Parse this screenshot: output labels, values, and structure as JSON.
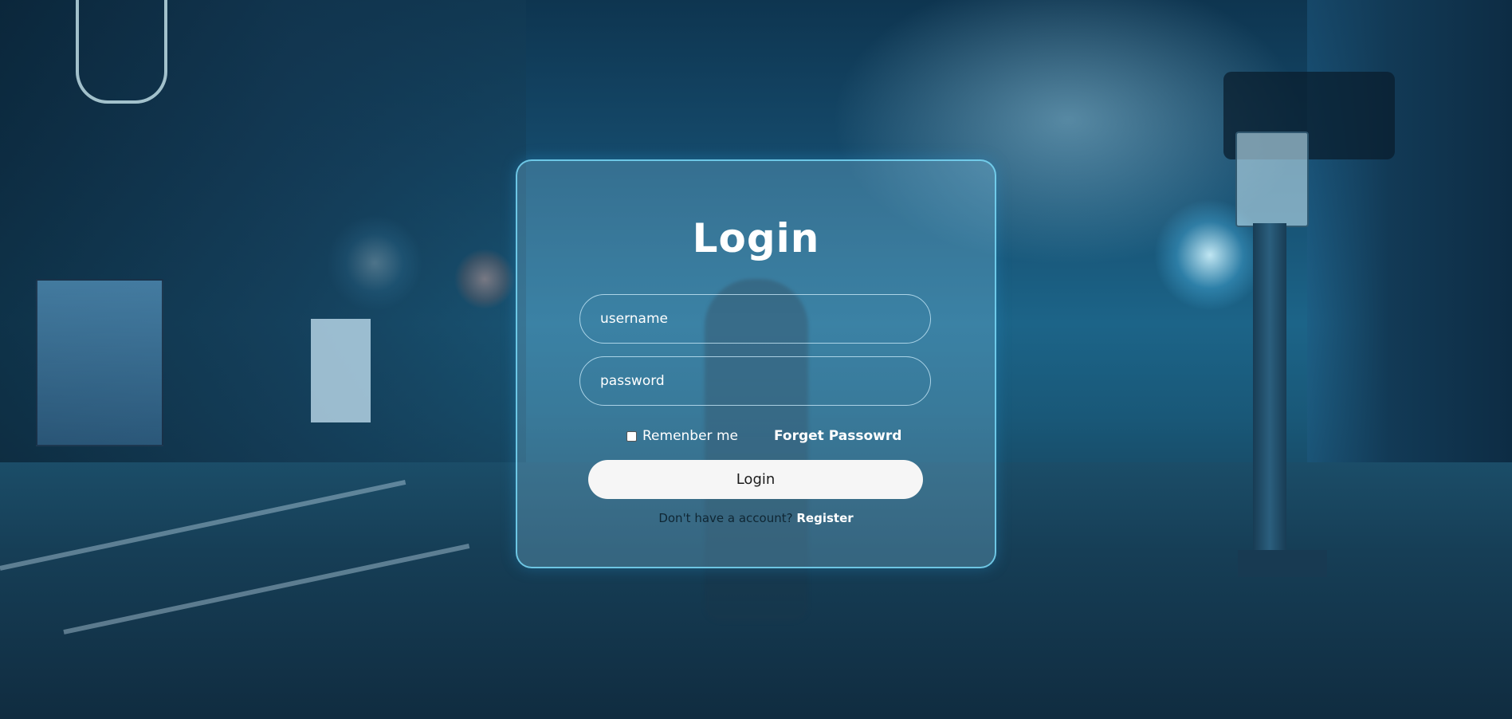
{
  "page": {
    "title": "Login"
  },
  "form": {
    "username_placeholder": "username",
    "password_placeholder": "password",
    "remember_label": "Remenber me",
    "remember_checked": false,
    "forget_label": "Forget Passowrd",
    "submit_label": "Login",
    "register_prompt": "Don't have a account?",
    "register_label": "Register"
  },
  "colors": {
    "card_border": "#78d7f5",
    "text_primary": "#ffffff",
    "button_bg": "#f6f6f6",
    "button_text": "#1b1b1b"
  }
}
